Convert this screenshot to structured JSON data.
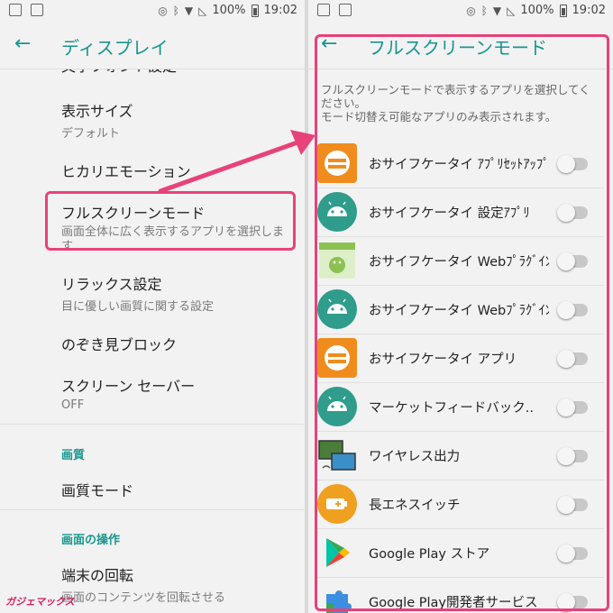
{
  "status_bar": {
    "battery": "100%",
    "time": "19:02"
  },
  "left": {
    "title": "ディスプレイ",
    "partial_item": "文字フォント設定",
    "items": [
      {
        "title": "表示サイズ",
        "subtitle": "デフォルト"
      },
      {
        "title": "ヒカリエモーション"
      },
      {
        "title": "フルスクリーンモード",
        "subtitle": "画面全体に広く表示するアプリを選択しま す"
      },
      {
        "title": "リラックス設定",
        "subtitle": "目に優しい画質に関する設定"
      },
      {
        "title": "のぞき見ブロック"
      },
      {
        "title": "スクリーン セーバー",
        "subtitle": "OFF"
      },
      {
        "title": "画質モード"
      },
      {
        "title": "端末の回転",
        "subtitle": "画面のコンテンツを回転させる"
      }
    ],
    "sections": [
      "画質",
      "画面の操作"
    ]
  },
  "right": {
    "title": "フルスクリーンモード",
    "description": "フルスクリーンモードで表示するアプリを選択してください。\nモード切替え可能なアプリのみ表示されます。",
    "apps": [
      {
        "label": "おサイフケータイ ｱﾌﾟﾘｾｯﾄｱｯﾌﾟ",
        "icon": "osaifu-icon",
        "enabled": false
      },
      {
        "label": "おサイフケータイ 設定ｱﾌﾟﾘ",
        "icon": "android-icon",
        "enabled": false
      },
      {
        "label": "おサイフケータイ Webﾌﾟﾗｸﾞｲﾝ",
        "icon": "android-package-icon",
        "enabled": false
      },
      {
        "label": "おサイフケータイ Webﾌﾟﾗｸﾞｲﾝｾｯﾄｱ..",
        "icon": "android-icon",
        "enabled": false
      },
      {
        "label": "おサイフケータイ アプリ",
        "icon": "osaifu-icon",
        "enabled": false
      },
      {
        "label": "マーケットフィードバック..",
        "icon": "android-icon",
        "enabled": false
      },
      {
        "label": "ワイヤレス出力",
        "icon": "wireless-output-icon",
        "enabled": false
      },
      {
        "label": "長エネスイッチ",
        "icon": "battery-saver-icon",
        "enabled": false
      },
      {
        "label": "Google Play ストア",
        "icon": "play-store-icon",
        "enabled": false
      },
      {
        "label": "Google Play開発者サービス",
        "icon": "play-services-icon",
        "enabled": false
      }
    ]
  },
  "watermark": "ガジェマックス",
  "colors": {
    "accent": "#17968e",
    "highlight": "#e8427a",
    "osaifu_orange": "#f08c1e",
    "android_teal": "#2f9c8c"
  }
}
